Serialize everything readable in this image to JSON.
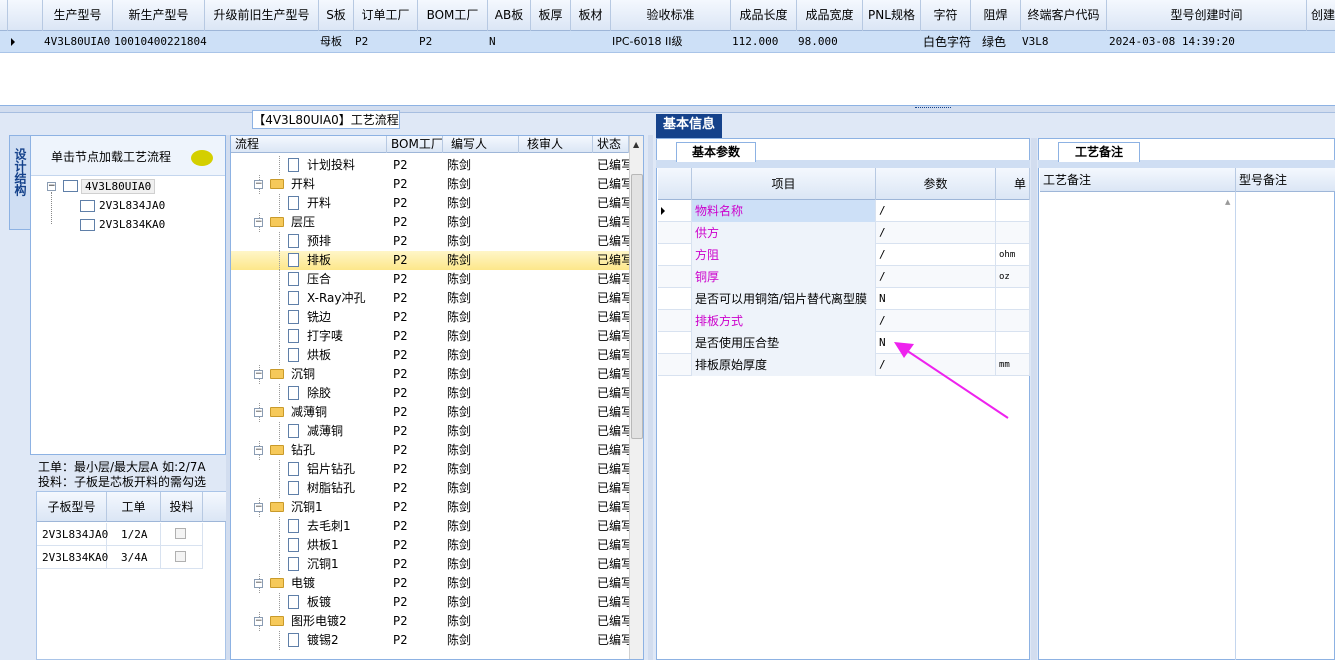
{
  "top_grid": {
    "columns": [
      "生产型号",
      "新生产型号",
      "升级前旧生产型号",
      "S板",
      "订单工厂",
      "BOM工厂",
      "AB板",
      "板厚",
      "板材",
      "验收标准",
      "成品长度",
      "成品宽度",
      "PNL规格",
      "字符",
      "阻焊",
      "终端客户代码",
      "型号创建时间",
      "创建"
    ],
    "row": {
      "prod_model": "4V3L80UIA0",
      "new_model": "10010400221804",
      "old_model": "",
      "s_board": "母板",
      "order_factory": "P2",
      "bom_factory": "P2",
      "ab_board": "N",
      "thickness": "",
      "material": "",
      "standard": "IPC-6018 II级",
      "length": "112.000",
      "width": "98.000",
      "pnl": "",
      "char": "白色字符",
      "solder": "绿色",
      "customer": "V3L8",
      "created": "2024-03-08 14:39:20"
    }
  },
  "left": {
    "tab_title": "【4V3L80UIA0】工艺流程",
    "vertical_tab": "设计结构",
    "tree_header": "单击节点加载工艺流程",
    "tree": [
      "4V3L80UIA0",
      "2V3L834JA0",
      "2V3L834KA0"
    ],
    "note1": "工单：最小层/最大层A 如:2/7A",
    "note2": "投料：子板是芯板开料的需勾选",
    "sub_headers": [
      "子板型号",
      "工单",
      "投料"
    ],
    "sub_rows": [
      {
        "model": "2V3L834JA0",
        "order": "1/2A"
      },
      {
        "model": "2V3L834KA0",
        "order": "3/4A"
      }
    ]
  },
  "process": {
    "headers": [
      "流程",
      "BOM工厂",
      "编写人",
      "核审人",
      "状态"
    ],
    "rows": [
      {
        "name": "计划投料",
        "level": 1,
        "factory": "P2",
        "writer": "陈剑",
        "status": "已编写"
      },
      {
        "name": "开料",
        "level": 0,
        "factory": "P2",
        "writer": "陈剑",
        "status": "已编写"
      },
      {
        "name": "开料",
        "level": 1,
        "factory": "P2",
        "writer": "陈剑",
        "status": "已编写"
      },
      {
        "name": "层压",
        "level": 0,
        "factory": "P2",
        "writer": "陈剑",
        "status": "已编写"
      },
      {
        "name": "预排",
        "level": 1,
        "factory": "P2",
        "writer": "陈剑",
        "status": "已编写"
      },
      {
        "name": "排板",
        "level": 1,
        "factory": "P2",
        "writer": "陈剑",
        "status": "已编写",
        "selected": true
      },
      {
        "name": "压合",
        "level": 1,
        "factory": "P2",
        "writer": "陈剑",
        "status": "已编写"
      },
      {
        "name": "X-Ray冲孔",
        "level": 1,
        "factory": "P2",
        "writer": "陈剑",
        "status": "已编写"
      },
      {
        "name": "铣边",
        "level": 1,
        "factory": "P2",
        "writer": "陈剑",
        "status": "已编写"
      },
      {
        "name": "打字唛",
        "level": 1,
        "factory": "P2",
        "writer": "陈剑",
        "status": "已编写"
      },
      {
        "name": "烘板",
        "level": 1,
        "factory": "P2",
        "writer": "陈剑",
        "status": "已编写"
      },
      {
        "name": "沉铜",
        "level": 0,
        "factory": "P2",
        "writer": "陈剑",
        "status": "已编写"
      },
      {
        "name": "除胶",
        "level": 1,
        "factory": "P2",
        "writer": "陈剑",
        "status": "已编写"
      },
      {
        "name": "减薄铜",
        "level": 0,
        "factory": "P2",
        "writer": "陈剑",
        "status": "已编写"
      },
      {
        "name": "减薄铜",
        "level": 1,
        "factory": "P2",
        "writer": "陈剑",
        "status": "已编写"
      },
      {
        "name": "钻孔",
        "level": 0,
        "factory": "P2",
        "writer": "陈剑",
        "status": "已编写"
      },
      {
        "name": "铝片钻孔",
        "level": 1,
        "factory": "P2",
        "writer": "陈剑",
        "status": "已编写"
      },
      {
        "name": "树脂钻孔",
        "level": 1,
        "factory": "P2",
        "writer": "陈剑",
        "status": "已编写"
      },
      {
        "name": "沉铜1",
        "level": 0,
        "factory": "P2",
        "writer": "陈剑",
        "status": "已编写"
      },
      {
        "name": "去毛刺1",
        "level": 1,
        "factory": "P2",
        "writer": "陈剑",
        "status": "已编写"
      },
      {
        "name": "烘板1",
        "level": 1,
        "factory": "P2",
        "writer": "陈剑",
        "status": "已编写"
      },
      {
        "name": "沉铜1",
        "level": 1,
        "factory": "P2",
        "writer": "陈剑",
        "status": "已编写"
      },
      {
        "name": "电镀",
        "level": 0,
        "factory": "P2",
        "writer": "陈剑",
        "status": "已编写"
      },
      {
        "name": "板镀",
        "level": 1,
        "factory": "P2",
        "writer": "陈剑",
        "status": "已编写"
      },
      {
        "name": "图形电镀2",
        "level": 0,
        "factory": "P2",
        "writer": "陈剑",
        "status": "已编写"
      },
      {
        "name": "镀锡2",
        "level": 1,
        "factory": "P2",
        "writer": "陈剑",
        "status": "已编写"
      }
    ]
  },
  "info": {
    "tab": "基本信息",
    "sub_tab": "基本参数",
    "headers": [
      "项目",
      "参数",
      "单位"
    ],
    "rows": [
      {
        "item": "物料名称",
        "value": "/",
        "unit": "",
        "magenta": true
      },
      {
        "item": "供方",
        "value": "/",
        "unit": "",
        "magenta": true
      },
      {
        "item": "方阻",
        "value": "/",
        "unit": "ohm",
        "magenta": true
      },
      {
        "item": "铜厚",
        "value": "/",
        "unit": "oz",
        "magenta": true
      },
      {
        "item": "是否可以用铜箔/铝片替代离型膜",
        "value": "N",
        "unit": "",
        "magenta": false
      },
      {
        "item": "排板方式",
        "value": "/",
        "unit": "",
        "magenta": true
      },
      {
        "item": "是否使用压合垫",
        "value": "N",
        "unit": "",
        "magenta": false
      },
      {
        "item": "排板原始厚度",
        "value": "/",
        "unit": "mm",
        "magenta": false
      }
    ]
  },
  "remark": {
    "tab": "工艺备注",
    "headers": [
      "工艺备注",
      "型号备注"
    ]
  },
  "colors": {
    "accent": "#15428b",
    "magenta": "#cc00cc",
    "arrow": "#ee22ee"
  }
}
